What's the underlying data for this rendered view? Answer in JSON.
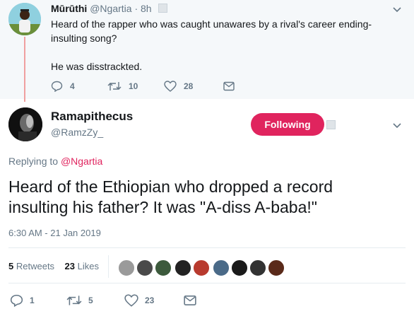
{
  "parent_tweet": {
    "name": "Mūrūthi",
    "handle": "@Ngartia",
    "time": "8h",
    "text_line1": "Heard of the rapper who was caught unawares by a rival's career ending-",
    "text_line2": "insulting song?",
    "text_line3": "He was disstrackted.",
    "reply_count": "4",
    "retweet_count": "10",
    "like_count": "28"
  },
  "main_tweet": {
    "name": "Ramapithecus",
    "handle": "@RamzZy_",
    "follow_label": "Following",
    "replying_prefix": "Replying to",
    "replying_to": "@Ngartia",
    "text_line1": "Heard of the Ethiopian who dropped a record",
    "text_line2": "insulting his father? It was \"A-diss A-baba!\"",
    "timestamp": "6:30 AM - 21 Jan 2019",
    "retweets_count": "5",
    "retweets_label": "Retweets",
    "likes_count": "23",
    "likes_label": "Likes",
    "reply_count": "1",
    "retweet_count": "5",
    "like_count": "23"
  },
  "colors": {
    "accent": "#e0245e",
    "muted": "#657786",
    "thread_line": "#f0a0a0"
  },
  "icons": [
    "reply-icon",
    "retweet-icon",
    "like-icon",
    "direct-message-icon",
    "chevron-down-icon",
    "verified-badge-icon"
  ]
}
